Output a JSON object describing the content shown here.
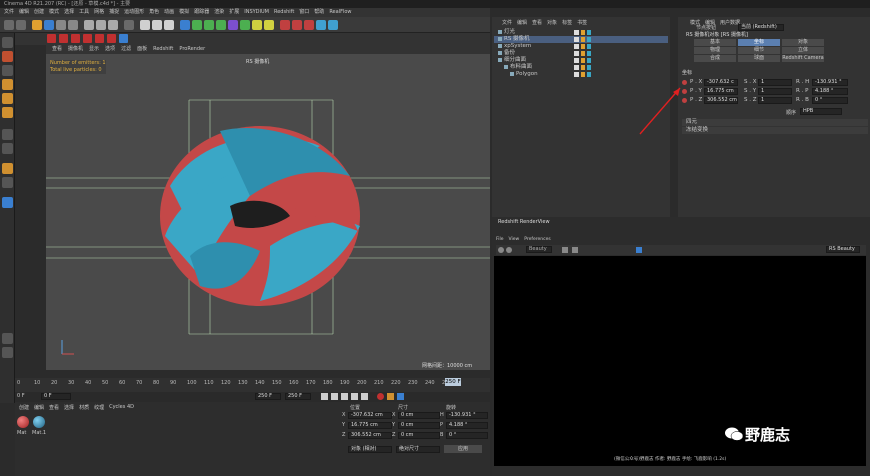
{
  "window": {
    "title": "Cinema 4D R21.207 (RC) - [还原 - 草模.c4d *] - 主要"
  },
  "menubar": [
    "文件",
    "编辑",
    "创建",
    "模式",
    "选择",
    "工具",
    "网格",
    "捕捉",
    "运动图形",
    "角色",
    "动画",
    "模拟",
    "跟踪器",
    "渲染",
    "扩展",
    "INSYDIUM",
    "Redshift",
    "窗口",
    "帮助",
    "RealFlow"
  ],
  "viewport": {
    "label": "RS 摄像机",
    "menu": [
      "查看",
      "摄像机",
      "显示",
      "选项",
      "过滤",
      "面板",
      "Redshift",
      "ProRender"
    ],
    "stats": {
      "emitters": "Number of emitters: 1",
      "particles": "Total live particles: 0"
    },
    "grid_distance": "网格间距：10000 cm"
  },
  "timeline": {
    "ticks": [
      "0",
      "10",
      "20",
      "30",
      "40",
      "50",
      "60",
      "70",
      "80",
      "90",
      "100",
      "110",
      "120",
      "130",
      "140",
      "150",
      "160",
      "170",
      "180",
      "190",
      "200",
      "210",
      "220",
      "230",
      "240",
      "250"
    ],
    "current": "0 F",
    "start_field": "0 F",
    "end_field": "250 F",
    "end2": "250 F",
    "frame_box": "250 F"
  },
  "material_panel": {
    "menu": [
      "创建",
      "编辑",
      "查看",
      "选择",
      "材质",
      "纹理",
      "Cycles 4D"
    ],
    "materials": [
      "Mat",
      "Mat.1"
    ]
  },
  "coords": {
    "headers": [
      "位置",
      "尺寸",
      "旋转"
    ],
    "rows": [
      {
        "axis": "X",
        "pos": "-307.632 cm",
        "size_axis": "X",
        "size": "0 cm",
        "rot_axis": "H",
        "rot": "-130.931 °"
      },
      {
        "axis": "Y",
        "pos": "16.775 cm",
        "size_axis": "Y",
        "size": "0 cm",
        "rot_axis": "P",
        "rot": "4.188 °"
      },
      {
        "axis": "Z",
        "pos": "306.552 cm",
        "size_axis": "Z",
        "size": "0 cm",
        "rot_axis": "B",
        "rot": "0 °"
      }
    ],
    "mode1": "对象 (相对)",
    "mode2": "绝对尺寸",
    "apply": "应用"
  },
  "object_manager": {
    "menu": [
      "文件",
      "编辑",
      "查看",
      "对象",
      "标签",
      "书签"
    ],
    "objects": [
      {
        "name": "灯光",
        "indent": 0
      },
      {
        "name": "RS 摄像机",
        "indent": 0
      },
      {
        "name": "xpSystem",
        "indent": 0
      },
      {
        "name": "备份",
        "indent": 0
      },
      {
        "name": "细分曲面",
        "indent": 0
      },
      {
        "name": "布料曲面",
        "indent": 1
      },
      {
        "name": "Polygon",
        "indent": 2
      }
    ]
  },
  "attr_manager": {
    "menu": [
      "模式",
      "编辑",
      "用户数据"
    ],
    "node_label": "节点按钮",
    "node_value": "当前 (Redshift)",
    "layer": "RS 摄像机对象 [RS 摄像机]",
    "tabs_row1": [
      "基本",
      "坐标",
      "对象"
    ],
    "tabs_row2": [
      "物理",
      "细节",
      "立体"
    ],
    "tabs_row3": [
      "合成",
      "球面",
      "Redshift Camera"
    ],
    "section": "坐标",
    "fields": [
      {
        "p": "P . X",
        "pv": "-307.632 c",
        "s": "S . X",
        "sv": "1",
        "r": "R . H",
        "rv": "-130.931 °"
      },
      {
        "p": "P . Y",
        "pv": "16.775 cm",
        "s": "S . Y",
        "sv": "1",
        "r": "R . P",
        "rv": "4.188 °"
      },
      {
        "p": "P . Z",
        "pv": "306.552 cm",
        "s": "S . Z",
        "sv": "1",
        "r": "R . B",
        "rv": "0 °"
      }
    ],
    "order_label": "顺序",
    "order_value": "HPB",
    "collapsed": [
      "四元",
      "冻结变换"
    ]
  },
  "rsview": {
    "title": "Redshift RenderView",
    "menu": [
      "File",
      "View",
      "Preferences"
    ],
    "dropdown": "RS Beauty",
    "zoom_left": "Beauty",
    "status": "(微信公众号)野鹿志   作者: 野鹿志   手绘: 飞鹿影响   (1.2s)"
  },
  "watermark": "野鹿志",
  "colors": {
    "accent": "#5b7fb0",
    "red": "#d84a4a",
    "cyan": "#3aa7c6"
  }
}
